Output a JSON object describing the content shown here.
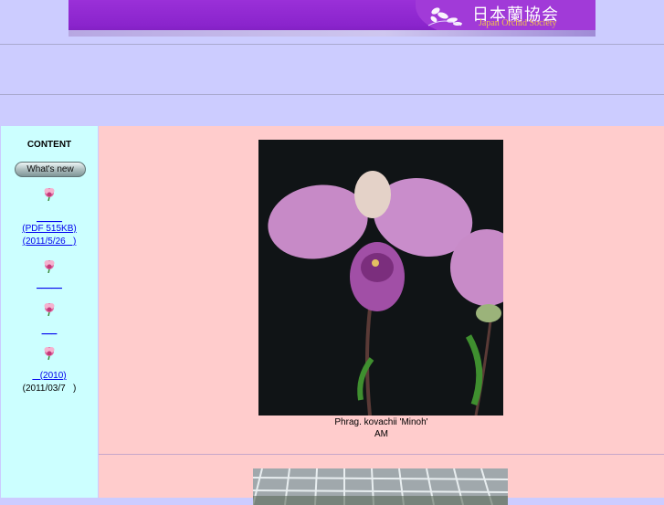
{
  "header": {
    "logo_jp": "日本蘭協会",
    "logo_en": "Japan Orchid Society"
  },
  "sidebar": {
    "title": "CONTENT",
    "whats_new_button": "What's new",
    "items": [
      {
        "link_line1": "_____",
        "link_line2": "(PDF 515KB)",
        "link_line3": "(2011/5/26   )"
      },
      {
        "link_line1": "_____"
      },
      {
        "link_line1": "___"
      },
      {
        "link_line1": "   (2010)",
        "text_line2": "(2011/03/7   )"
      }
    ]
  },
  "main": {
    "photo_caption_line1": "Phrag. kovachii 'Minoh'",
    "photo_caption_line2": "AM"
  },
  "colors": {
    "page_bg": "#ccccff",
    "sidebar_bg": "#ccffff",
    "main_bg": "#ffcccc",
    "banner_purple": "#8a24cc",
    "link": "#0000ee"
  }
}
